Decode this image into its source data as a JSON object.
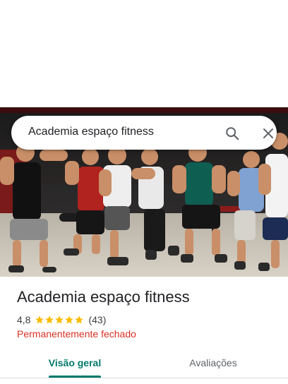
{
  "search": {
    "query": "Academia espaço fitness"
  },
  "icons": {
    "search": "search-icon",
    "close": "close-icon",
    "star": "star-icon"
  },
  "place": {
    "name": "Academia espaço fitness",
    "rating": "4,8",
    "stars_filled": 5,
    "review_count": "(43)",
    "status": "Permanentemente fechado"
  },
  "tabs": [
    {
      "label": "Visão geral",
      "selected": true
    },
    {
      "label": "Avaliações",
      "selected": false
    }
  ],
  "colors": {
    "accent": "#00796b",
    "star": "#fbbc04",
    "status_closed": "#d93025",
    "text_primary": "#202124",
    "text_secondary": "#5f6368"
  }
}
